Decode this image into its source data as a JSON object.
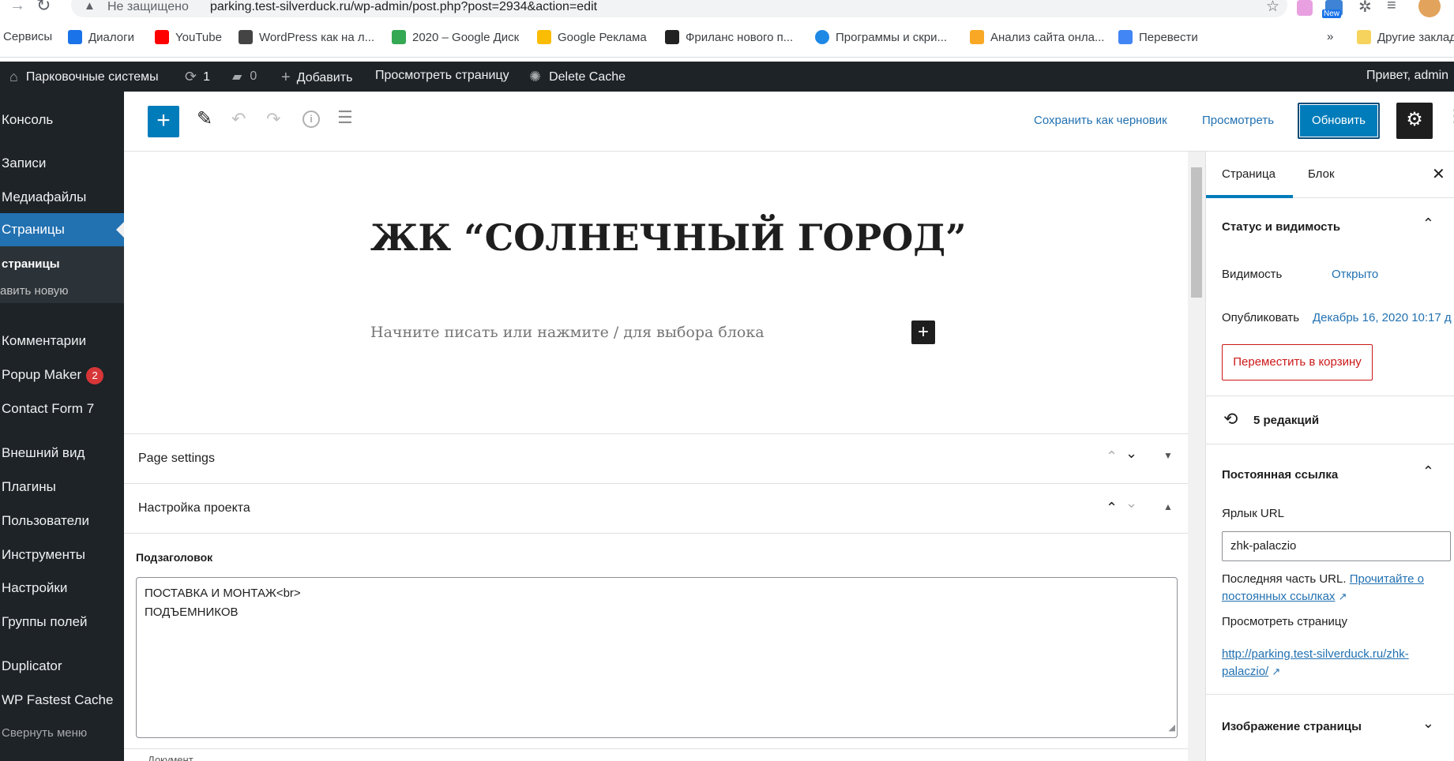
{
  "browser": {
    "not_secure": "Не защищено",
    "url": "parking.test-silverduck.ru/wp-admin/post.php?post=2934&action=edit",
    "extension_badge": "New",
    "bookmarks": [
      "Сервисы",
      "Диалоги",
      "YouTube",
      "WordPress как на л...",
      "2020 – Google Диск",
      "Google Реклама",
      "Фриланс нового п...",
      "Программы и скри...",
      "Анализ сайта онла...",
      "Перевести",
      "»",
      "Другие заклад"
    ]
  },
  "adminbar": {
    "site": "Парковочные системы",
    "updates": "1",
    "comments": "0",
    "add": "Добавить",
    "view_page": "Просмотреть страницу",
    "delete_cache": "Delete Cache",
    "greeting": "Привет, admin"
  },
  "sidebar": {
    "console": "Консоль",
    "posts": "Записи",
    "media": "Медиафайлы",
    "pages": "Страницы",
    "sub_pages": "страницы",
    "sub_add": "авить новую",
    "comments": "Комментарии",
    "popup": "Popup Maker",
    "popup_badge": "2",
    "cf7": "Contact Form 7",
    "appearance": "Внешний вид",
    "plugins": "Плагины",
    "users": "Пользователи",
    "tools": "Инструменты",
    "settings": "Настройки",
    "field_groups": "Группы полей",
    "duplicator": "Duplicator",
    "wpfc": "WP Fastest Cache",
    "collapse": "Свернуть меню"
  },
  "editor": {
    "save_draft": "Сохранить как черновик",
    "preview": "Просмотреть",
    "update": "Обновить",
    "title": "ЖК “СОЛНЕЧНЫЙ ГОРОД”",
    "placeholder": "Начните писать или нажмите / для выбора блока",
    "page_settings": "Page settings",
    "project_settings": "Настройка проекта",
    "subtitle_label": "Подзаголовок",
    "subtitle_line1": "ПОСТАВКА И МОНТАЖ<br>",
    "subtitle_line2": "ПОДЪЕМНИКОВ",
    "footer_hint": "Документ"
  },
  "settings": {
    "tab_page": "Страница",
    "tab_block": "Блок",
    "status_title": "Статус и видимость",
    "visibility_label": "Видимость",
    "visibility_value": "Открыто",
    "publish_label": "Опубликовать",
    "publish_value": "Декабрь 16, 2020 10:17 д",
    "trash": "Переместить в корзину",
    "revisions": "5 редакций",
    "permalink_title": "Постоянная ссылка",
    "slug_label": "Ярлык URL",
    "slug_value": "zhk-palaczio",
    "last_part_text": "Последняя часть URL.",
    "read_about_1": "Прочитайте о",
    "read_about_2": "постоянных ссылках",
    "view_page": "Просмотреть страницу",
    "url_line1": "http://parking.test-silverduck.ru/zhk-",
    "url_line2": "palaczio/",
    "featured_image": "Изображение страницы"
  },
  "colors": {
    "wp_blue": "#2271b1",
    "admin_dark": "#1d2327",
    "danger": "#cc1818",
    "inserter_blue": "#007cba"
  }
}
